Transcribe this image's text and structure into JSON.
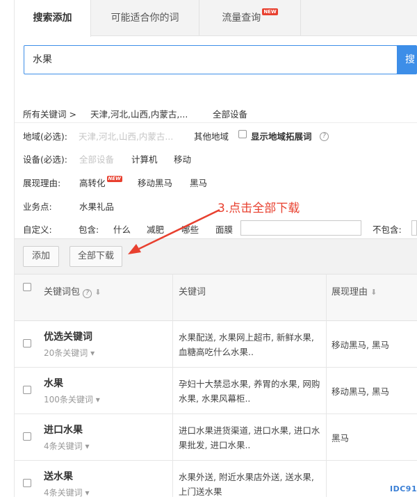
{
  "tabs": [
    {
      "label": "搜索添加",
      "active": true
    },
    {
      "label": "可能适合你的词",
      "active": false
    },
    {
      "label": "流量查询",
      "active": false,
      "badge": "NEW"
    }
  ],
  "search": {
    "value": "水果",
    "button_label": "搜"
  },
  "breadcrumb": {
    "label": "所有关键词 >",
    "regions": "天津,河北,山西,内蒙古,...",
    "device": "全部设备"
  },
  "region": {
    "label": "地域(必选):",
    "selected": "天津,河北,山西,内蒙古...",
    "other": "其他地域",
    "show_ext": "显示地域拓展词"
  },
  "device": {
    "label": "设备(必选):",
    "options": [
      "全部设备",
      "计算机",
      "移动"
    ]
  },
  "reason": {
    "label": "展现理由:",
    "options": [
      "高转化",
      "移动黑马",
      "黑马"
    ],
    "badge": "NEW"
  },
  "business": {
    "label": "业务点:",
    "value": "水果礼品"
  },
  "custom": {
    "label": "自定义:",
    "include_label": "包含:",
    "include_items": [
      "什么",
      "减肥",
      "哪些",
      "面膜"
    ],
    "exclude_label": "不包含:"
  },
  "annotation": {
    "text": "3.点击全部下载"
  },
  "actions": {
    "add": "添加",
    "download_all": "全部下载"
  },
  "table": {
    "headers": {
      "package": "关键词包",
      "keyword": "关键词",
      "reason": "展现理由"
    },
    "rows": [
      {
        "name": "优选关键词",
        "count": "20条关键词",
        "keywords": "水果配送, 水果网上超市, 新鲜水果, 血糖高吃什么水果..",
        "reason": "移动黑马, 黑马"
      },
      {
        "name": "水果",
        "count": "100条关键词",
        "keywords": "孕妇十大禁忌水果, 养胃的水果, 网购水果, 水果风幕柜..",
        "reason": "移动黑马, 黑马"
      },
      {
        "name": "进口水果",
        "count": "4条关键词",
        "keywords": "进口水果进货渠道, 进口水果, 进口水果批发, 进口水果..",
        "reason": "黑马"
      },
      {
        "name": "送水果",
        "count": "4条关键词",
        "keywords": "水果外送, 附近水果店外送, 送水果, 上门送水果",
        "reason": ""
      }
    ]
  },
  "watermark": "IDC91",
  "colors": {
    "accent": "#3d8ee8",
    "annotation": "#e8402f",
    "badge": "#e8402f"
  }
}
